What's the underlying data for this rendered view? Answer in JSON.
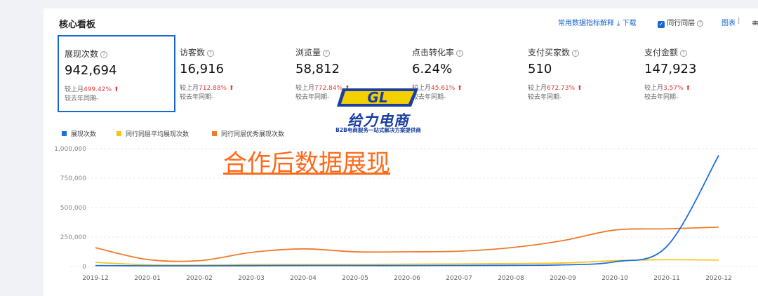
{
  "panel": {
    "title": "核心看板"
  },
  "toolbar": {
    "metric_help": "常用数据指标解释",
    "download": "下载",
    "peer_checkbox": "同行同层",
    "chart_view": "图表",
    "table_view_partial": "表格"
  },
  "metrics": [
    {
      "label": "展现次数",
      "value": "942,694",
      "cmp_prefix": "较上月",
      "cmp_pct": "499.42%",
      "yoy": "较去年同期-"
    },
    {
      "label": "访客数",
      "value": "16,916",
      "cmp_prefix": "较上月",
      "cmp_pct": "712.88%",
      "yoy": "较去年同期-"
    },
    {
      "label": "浏览量",
      "value": "58,812",
      "cmp_prefix": "较上月",
      "cmp_pct": "772.84%",
      "yoy": "较去年同期-"
    },
    {
      "label": "点击转化率",
      "value": "6.24%",
      "cmp_prefix": "较上月",
      "cmp_pct": "45.61%",
      "yoy": "较去年同期-"
    },
    {
      "label": "支付买家数",
      "value": "510",
      "cmp_prefix": "较上月",
      "cmp_pct": "672.73%",
      "yoy": "较去年同期-"
    },
    {
      "label": "支付金额",
      "value": "147,923",
      "cmp_prefix": "较上月",
      "cmp_pct": "3.57%",
      "yoy": "较去年同期-"
    }
  ],
  "logo": {
    "mark": "GL",
    "name": "给力电商",
    "tagline": "B2B电商服务一站式解决方案提供商"
  },
  "overlay_title": "合作后数据展现",
  "colors": {
    "accent": "#1966d2",
    "series_blue": "#1e6fe0",
    "series_yellow": "#f5c518",
    "series_orange": "#f07a2a",
    "up_red": "#e23b3b"
  },
  "chart_data": {
    "type": "line",
    "categories": [
      "2019-12",
      "2020-01",
      "2020-02",
      "2020-03",
      "2020-04",
      "2020-05",
      "2020-06",
      "2020-07",
      "2020-08",
      "2020-09",
      "2020-10",
      "2020-11",
      "2020-12"
    ],
    "series": [
      {
        "name": "展现次数",
        "values": [
          8000,
          6000,
          6000,
          7000,
          8000,
          8000,
          8000,
          9000,
          10000,
          14000,
          40000,
          170000,
          942694
        ]
      },
      {
        "name": "同行同层平均展现次数",
        "values": [
          35000,
          15000,
          12000,
          18000,
          18000,
          18000,
          20000,
          22000,
          25000,
          30000,
          50000,
          58000,
          55000
        ]
      },
      {
        "name": "同行同层优秀展现次数",
        "values": [
          160000,
          60000,
          50000,
          120000,
          150000,
          125000,
          125000,
          130000,
          160000,
          220000,
          310000,
          320000,
          335000
        ]
      }
    ],
    "yticks": [
      "1,000,000",
      "750,000",
      "500,000",
      "250,000",
      "0"
    ],
    "ylim": [
      0,
      1000000
    ],
    "legend": "top-left",
    "grid": true
  }
}
